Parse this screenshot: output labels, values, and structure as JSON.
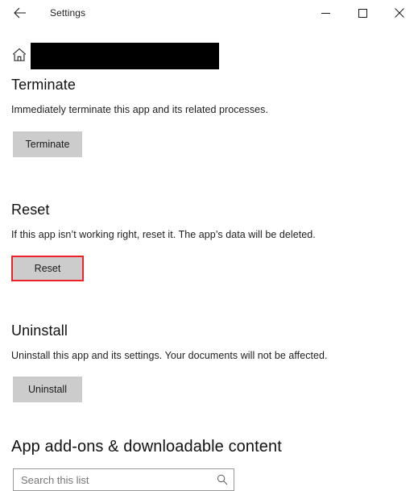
{
  "window": {
    "title": "Settings",
    "back_icon": "back-arrow-icon",
    "minimize_icon": "minimize-icon",
    "maximize_icon": "maximize-icon",
    "close_icon": "close-icon"
  },
  "header": {
    "home_icon": "home-icon",
    "breadcrumb_redacted": ""
  },
  "sections": [
    {
      "heading": "Terminate",
      "description": "Immediately terminate this app and its related processes.",
      "button_label": "Terminate",
      "highlighted": false
    },
    {
      "heading": "Reset",
      "description": "If this app isn’t working right, reset it. The app’s data will be deleted.",
      "button_label": "Reset",
      "highlighted": true
    },
    {
      "heading": "Uninstall",
      "description": "Uninstall this app and its settings. Your documents will not be affected.",
      "button_label": "Uninstall",
      "highlighted": false
    }
  ],
  "addons": {
    "heading": "App add-ons & downloadable content",
    "search_placeholder": "Search this list",
    "search_value": "",
    "search_icon": "search-icon"
  },
  "colors": {
    "page_background": "#ffffff",
    "button_face": "#cccccc",
    "highlight_red": "#ee2127",
    "redaction_black": "#000000",
    "text_primary": "#1a1a1a",
    "placeholder": "#767676",
    "input_border": "#9a9a9a"
  }
}
